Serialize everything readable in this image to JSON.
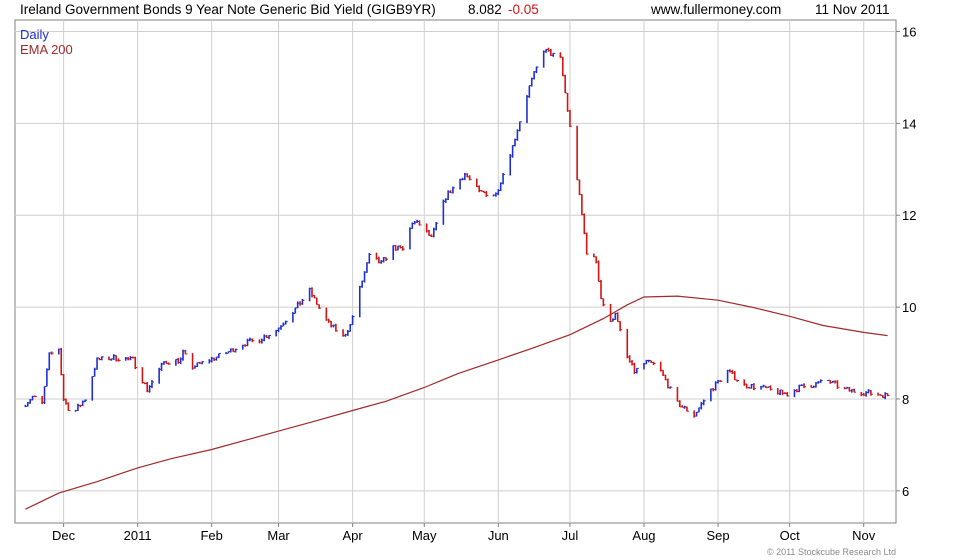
{
  "header": {
    "title": "Ireland Government Bonds 9 Year Note Generic Bid Yield (GIGB9YR)",
    "last_value": "8.082",
    "change": "-0.05",
    "site": "www.fullermoney.com",
    "date": "11 Nov 2011"
  },
  "footer": {
    "credit": "© 2011 Stockcube Research Ltd"
  },
  "chart_data": {
    "type": "candlestick",
    "title": "Ireland Government Bonds 9 Year Note Generic Bid Yield (GIGB9YR)",
    "legend": [
      {
        "name": "Daily",
        "color": "#1f2fd0"
      },
      {
        "name": "EMA 200",
        "color": "#a12a2a"
      }
    ],
    "legend_position": "top-left",
    "colors": {
      "up": "#1f2fd0",
      "down": "#d21414",
      "ema": "#a12a2a",
      "grid": "#cfcfcf"
    },
    "y_axis": {
      "position": "right",
      "ylim": [
        5.3,
        16.25
      ],
      "ticks": [
        6,
        8,
        10,
        12,
        14,
        16
      ]
    },
    "x_axis": {
      "ticks": [
        "Dec",
        "2011",
        "Feb",
        "Mar",
        "Apr",
        "May",
        "Jun",
        "Jul",
        "Aug",
        "Sep",
        "Oct",
        "Nov"
      ]
    },
    "grid": true,
    "series": [
      {
        "name": "Daily",
        "kind": "close_path",
        "x": [
          "2010-11-15",
          "2010-11-18",
          "2010-11-22",
          "2010-11-25",
          "2010-11-29",
          "2010-12-01",
          "2010-12-03",
          "2010-12-06",
          "2010-12-10",
          "2010-12-15",
          "2010-12-22",
          "2010-12-30",
          "2011-01-05",
          "2011-01-12",
          "2011-01-19",
          "2011-01-20",
          "2011-01-24",
          "2011-01-31",
          "2011-02-07",
          "2011-02-14",
          "2011-02-21",
          "2011-02-28",
          "2011-03-07",
          "2011-03-14",
          "2011-03-21",
          "2011-03-28",
          "2011-03-31",
          "2011-04-04",
          "2011-04-08",
          "2011-04-13",
          "2011-04-18",
          "2011-04-22",
          "2011-04-26",
          "2011-04-29",
          "2011-05-04",
          "2011-05-10",
          "2011-05-18",
          "2011-05-24",
          "2011-05-31",
          "2011-06-07",
          "2011-06-14",
          "2011-06-20",
          "2011-06-27",
          "2011-07-04",
          "2011-07-06",
          "2011-07-08",
          "2011-07-12",
          "2011-07-14",
          "2011-07-18",
          "2011-07-20",
          "2011-07-21",
          "2011-07-25",
          "2011-07-28",
          "2011-08-02",
          "2011-08-05",
          "2011-08-08",
          "2011-08-15",
          "2011-08-22",
          "2011-08-29",
          "2011-09-05",
          "2011-09-12",
          "2011-09-19",
          "2011-09-26",
          "2011-09-30",
          "2011-10-05",
          "2011-10-10",
          "2011-10-17",
          "2011-10-24",
          "2011-10-31",
          "2011-11-07",
          "2011-11-11"
        ],
        "values": [
          7.9,
          8.05,
          7.9,
          8.95,
          9.1,
          8.0,
          7.8,
          7.75,
          8.0,
          8.85,
          8.9,
          8.85,
          8.2,
          8.8,
          8.85,
          9.0,
          8.7,
          8.85,
          9.0,
          9.2,
          9.3,
          9.5,
          9.9,
          10.35,
          9.7,
          9.35,
          9.6,
          10.4,
          11.1,
          10.95,
          11.3,
          11.25,
          11.85,
          11.8,
          11.5,
          12.4,
          12.9,
          12.5,
          12.45,
          13.5,
          14.8,
          15.6,
          15.4,
          12.8,
          12.0,
          11.2,
          11.0,
          10.2,
          9.65,
          9.9,
          9.65,
          8.9,
          8.6,
          8.8,
          8.75,
          8.6,
          7.9,
          7.65,
          8.2,
          8.6,
          8.3,
          8.25,
          8.15,
          8.1,
          8.25,
          8.3,
          8.4,
          8.2,
          8.15,
          8.1,
          8.08
        ]
      },
      {
        "name": "EMA 200",
        "kind": "line",
        "x": [
          "2010-11-15",
          "2010-11-29",
          "2010-12-15",
          "2011-01-01",
          "2011-01-15",
          "2011-02-01",
          "2011-02-15",
          "2011-03-01",
          "2011-03-15",
          "2011-04-01",
          "2011-04-15",
          "2011-05-01",
          "2011-05-15",
          "2011-06-01",
          "2011-06-15",
          "2011-07-01",
          "2011-07-15",
          "2011-07-25",
          "2011-08-01",
          "2011-08-15",
          "2011-09-01",
          "2011-09-15",
          "2011-10-01",
          "2011-10-15",
          "2011-11-01",
          "2011-11-11"
        ],
        "values": [
          5.6,
          5.95,
          6.2,
          6.5,
          6.7,
          6.9,
          7.1,
          7.3,
          7.5,
          7.75,
          7.95,
          8.25,
          8.55,
          8.85,
          9.1,
          9.4,
          9.75,
          10.05,
          10.22,
          10.24,
          10.15,
          10.0,
          9.8,
          9.6,
          9.45,
          9.38
        ]
      }
    ]
  }
}
